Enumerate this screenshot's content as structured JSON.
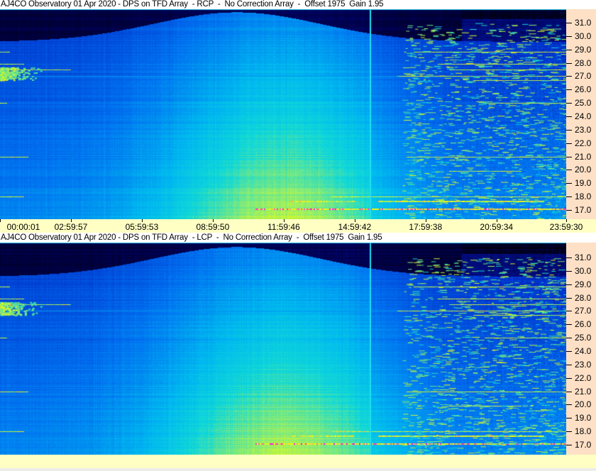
{
  "colors": {
    "title_bg": "#ffffff",
    "freq_axis_bg": "#fde0c6",
    "time_axis_bg": "#ffffc4",
    "marker_line": "#20e0f0",
    "colormap": [
      "#000000",
      "#000050",
      "#0020c0",
      "#0070f0",
      "#00b8f0",
      "#10d8d8",
      "#a0f060",
      "#ffff00",
      "#ff00ff"
    ]
  },
  "chart_data": [
    {
      "type": "heatmap",
      "title": "AJ4CO Observatory 01 Apr 2020 - DPS on TFD Array  - RCP  -  No Correction Array  -  Offset 1975  Gain 1.95",
      "polarization": "RCP",
      "x_tick_labels": [
        "00:00:01",
        "02:59:57",
        "05:59:53",
        "08:59:50",
        "11:59:46",
        "14:59:42",
        "17:59:38",
        "20:59:34",
        "23:59:30"
      ],
      "xlim_hours": [
        0,
        24
      ],
      "y_tick_labels": [
        "31.0",
        "30.0",
        "29.0",
        "28.0",
        "27.0",
        "26.0",
        "25.0",
        "24.0",
        "23.0",
        "22.0",
        "21.0",
        "20.0",
        "19.0",
        "18.0",
        "17.0"
      ],
      "y_ticks_mhz": [
        31,
        30,
        29,
        28,
        27,
        26,
        25,
        24,
        23,
        22,
        21,
        20,
        19,
        18,
        17
      ],
      "ylim_mhz": [
        16.3,
        32.0
      ],
      "y_axis_side": "right",
      "show_x_labels": true,
      "marker_time": "15:38",
      "rfi_lines_mhz": [
        28.8,
        27.9,
        27.5,
        27.0,
        26.7,
        25.0,
        21.0,
        19.9,
        18.0,
        17.7,
        17.1
      ]
    },
    {
      "type": "heatmap",
      "title": "AJ4CO Observatory 01 Apr 2020 - DPS on TFD Array  - LCP  -  No Correction Array  -  Offset 1975  Gain 1.95",
      "polarization": "LCP",
      "x_tick_labels": [],
      "xlim_hours": [
        0,
        24
      ],
      "y_tick_labels": [
        "31.0",
        "30.0",
        "29.0",
        "28.0",
        "27.0",
        "26.0",
        "25.0",
        "24.0",
        "23.0",
        "22.0",
        "21.0",
        "20.0",
        "19.0",
        "18.0",
        "17.0"
      ],
      "y_ticks_mhz": [
        31,
        30,
        29,
        28,
        27,
        26,
        25,
        24,
        23,
        22,
        21,
        20,
        19,
        18,
        17
      ],
      "ylim_mhz": [
        16.3,
        32.0
      ],
      "y_axis_side": "right",
      "show_x_labels": false,
      "marker_time": "15:38",
      "rfi_lines_mhz": [
        28.8,
        27.9,
        27.5,
        27.0,
        26.7,
        25.0,
        21.0,
        19.9,
        18.0,
        17.7,
        17.1
      ]
    }
  ]
}
